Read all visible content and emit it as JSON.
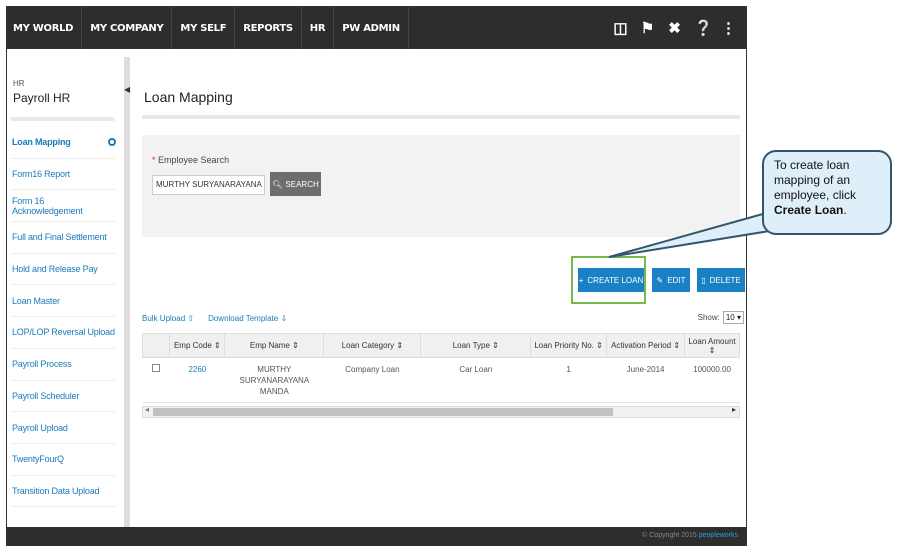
{
  "topnav": {
    "items": [
      "MY WORLD",
      "MY COMPANY",
      "MY SELF",
      "REPORTS",
      "HR",
      "PW ADMIN"
    ],
    "icons": [
      "book-icon",
      "flag-icon",
      "tools-icon",
      "help-icon",
      "share-icon"
    ]
  },
  "sidebar": {
    "module": "HR",
    "title": "Payroll HR",
    "items": [
      {
        "label": "Loan Mapping"
      },
      {
        "label": "Form16 Report"
      },
      {
        "label": "Form 16 Acknowledgement"
      },
      {
        "label": "Full and Final Settlement"
      },
      {
        "label": "Hold and Release Pay"
      },
      {
        "label": "Loan Master"
      },
      {
        "label": "LOP/LOP Reversal Upload"
      },
      {
        "label": "Payroll Process"
      },
      {
        "label": "Payroll Scheduler"
      },
      {
        "label": "Payroll Upload"
      },
      {
        "label": "TwentyFourQ"
      },
      {
        "label": "Transition Data Upload"
      }
    ]
  },
  "main": {
    "title": "Loan Mapping",
    "search": {
      "required_mark": "*",
      "label": "Employee Search",
      "value": "MURTHY SURYANARAYANA MAN",
      "button": "SEARCH"
    },
    "actions": {
      "create": "CREATE LOAN",
      "edit": "EDIT",
      "delete": "DELETE"
    },
    "links": {
      "bulk_upload": "Bulk Upload",
      "download_template": "Download Template"
    },
    "show_label": "Show:",
    "show_value": "10",
    "table": {
      "headers": [
        "Emp Code",
        "Emp Name",
        "Loan Category",
        "Loan Type",
        "Loan Priority No.",
        "Activation Period",
        "Loan Amount"
      ],
      "rows": [
        {
          "emp_code": "2260",
          "emp_name_1": "MURTHY",
          "emp_name_2": "SURYANARAYANA",
          "emp_name_3": "MANDA",
          "loan_category": "Company Loan",
          "loan_type": "Car Loan",
          "priority": "1",
          "activation": "June-2014",
          "amount": "100000.00"
        }
      ]
    }
  },
  "footer": {
    "copyright": "© Copyright 2015",
    "brand": "peopleworks"
  },
  "callout": {
    "text_1": "To create loan",
    "text_2": "mapping of an",
    "text_3": "employee, click",
    "text_bold": "Create Loan",
    "text_end": "."
  }
}
